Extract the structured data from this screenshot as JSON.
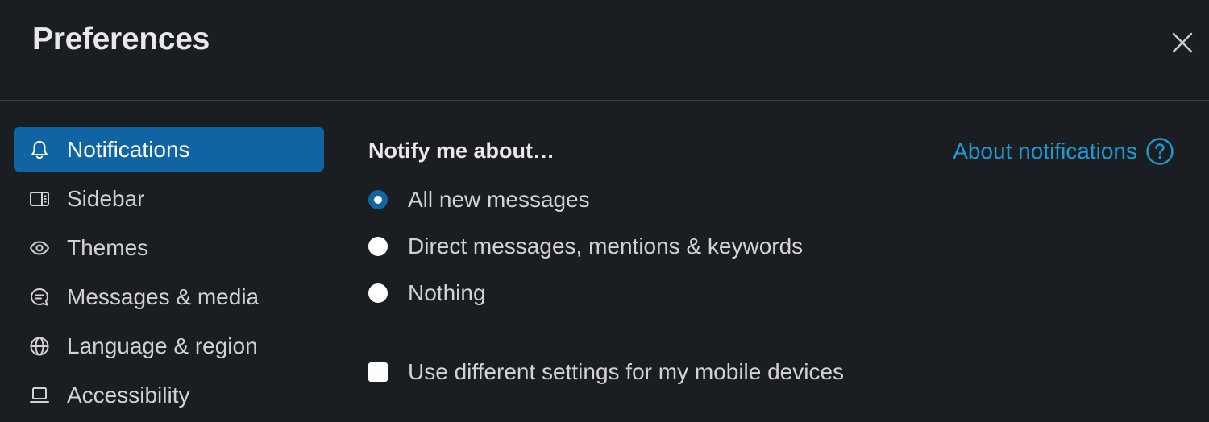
{
  "header": {
    "title": "Preferences"
  },
  "sidebar": {
    "items": [
      {
        "label": "Notifications",
        "icon": "bell-icon",
        "active": true
      },
      {
        "label": "Sidebar",
        "icon": "sidebar-panel-icon",
        "active": false
      },
      {
        "label": "Themes",
        "icon": "eye-icon",
        "active": false
      },
      {
        "label": "Messages & media",
        "icon": "message-bubble-icon",
        "active": false
      },
      {
        "label": "Language & region",
        "icon": "globe-icon",
        "active": false
      },
      {
        "label": "Accessibility",
        "icon": "laptop-icon",
        "active": false
      }
    ]
  },
  "main": {
    "section_title": "Notify me about…",
    "about_link": "About notifications",
    "options": [
      {
        "label": "All new messages",
        "checked": true
      },
      {
        "label": "Direct messages, mentions & keywords",
        "checked": false
      },
      {
        "label": "Nothing",
        "checked": false
      }
    ],
    "mobile_checkbox": {
      "label": "Use different settings for my mobile devices",
      "checked": false
    }
  },
  "colors": {
    "background": "#1a1d21",
    "active_item": "#1164a3",
    "link": "#1d9bd1",
    "radio_selected": "#1264a3"
  }
}
